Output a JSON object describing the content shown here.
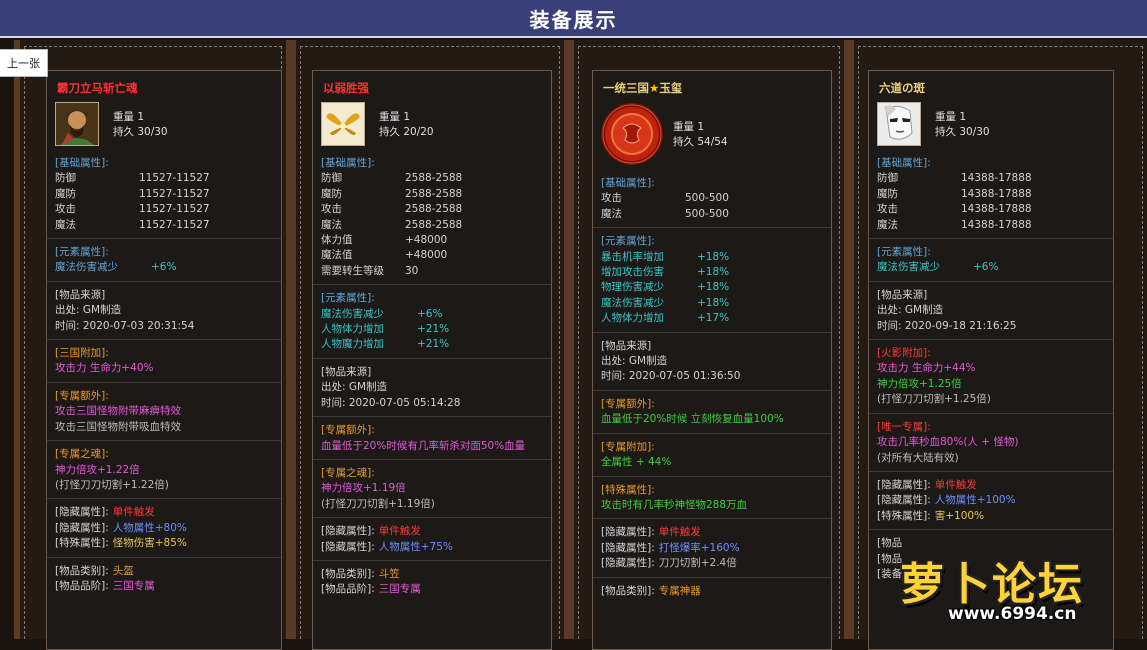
{
  "header": {
    "title": "装备展示"
  },
  "nav": {
    "prev_label": "上一张"
  },
  "cards": [
    {
      "name": "霸刀立马斩亡魂",
      "weight": "重量 1",
      "durability": "持久 30/30",
      "basic_title": "[基础属性]:",
      "basic": [
        {
          "k": "防御",
          "v": "11527-11527"
        },
        {
          "k": "魔防",
          "v": "11527-11527"
        },
        {
          "k": "攻击",
          "v": "11527-11527"
        },
        {
          "k": "魔法",
          "v": "11527-11527"
        }
      ],
      "element_title": "[元素属性]:",
      "elements": [
        {
          "k": "魔法伤害减少",
          "v": "+6%"
        }
      ],
      "source_title": "[物品来源]",
      "source_from": "出处: GM制造",
      "source_time": "时间: 2020-07-03 20:31:54",
      "s1_title": "[三国附加]:",
      "s1_line": "攻击力 生命力+40%",
      "s2_title": "[专属额外]:",
      "s2_line1": "攻击三国怪物附带麻痹特效",
      "s2_line2": "攻击三国怪物附带吸血特效",
      "s3_title": "[专属之魂]:",
      "s3_line1": "神力倍攻+1.22倍",
      "s3_line2": "(打怪刀刀切割+1.22倍)",
      "hidden": [
        {
          "l": "[隐藏属性]:",
          "v": "单件触发",
          "c": "red"
        },
        {
          "l": "[隐藏属性]:",
          "v": "人物属性+80%",
          "c": "blue"
        },
        {
          "l": "[特殊属性]:",
          "v": "怪物伤害+85%",
          "c": "yellow"
        }
      ],
      "category": [
        {
          "l": "[物品类别]:",
          "v": "头盔",
          "c": "orange"
        },
        {
          "l": "[物品品阶]:",
          "v": "三国专属",
          "c": "magenta"
        }
      ]
    },
    {
      "name": "以弱胜强",
      "weight": "重量 1",
      "durability": "持久 20/20",
      "basic_title": "[基础属性]:",
      "basic": [
        {
          "k": "防御",
          "v": "2588-2588"
        },
        {
          "k": "魔防",
          "v": "2588-2588"
        },
        {
          "k": "攻击",
          "v": "2588-2588"
        },
        {
          "k": "魔法",
          "v": "2588-2588"
        },
        {
          "k": "体力值",
          "v": "+48000"
        },
        {
          "k": "魔法值",
          "v": "+48000"
        },
        {
          "k": "需要转生等级",
          "v": "30"
        }
      ],
      "element_title": "[元素属性]:",
      "elements": [
        {
          "k": "魔法伤害减少",
          "v": "+6%"
        },
        {
          "k": "人物体力增加",
          "v": "+21%"
        },
        {
          "k": "人物魔力增加",
          "v": "+21%"
        }
      ],
      "source_title": "[物品来源]",
      "source_from": "出处: GM制造",
      "source_time": "时间: 2020-07-05 05:14:28",
      "s1_title": "[专属额外]:",
      "s1_line": "血量低于20%时候有几率斩杀对面50%血量",
      "s2_title": "[专属之魂]:",
      "s2_line1": "神力倍攻+1.19倍",
      "s2_line2": "(打怪刀刀切割+1.19倍)",
      "hidden": [
        {
          "l": "[隐藏属性]:",
          "v": "单件触发",
          "c": "red"
        },
        {
          "l": "[隐藏属性]:",
          "v": "人物属性+75%",
          "c": "blue"
        }
      ],
      "category": [
        {
          "l": "[物品类别]:",
          "v": "斗笠",
          "c": "orange"
        },
        {
          "l": "[物品品阶]:",
          "v": "三国专属",
          "c": "magenta"
        }
      ]
    },
    {
      "name_a": "一统三国",
      "name_star": "★",
      "name_b": "玉玺",
      "weight": "重量 1",
      "durability": "持久 54/54",
      "basic_title": "[基础属性]:",
      "basic": [
        {
          "k": "攻击",
          "v": "500-500"
        },
        {
          "k": "魔法",
          "v": "500-500"
        }
      ],
      "element_title": "[元素属性]:",
      "elements": [
        {
          "k": "暴击机率增加",
          "v": "+18%"
        },
        {
          "k": "增加攻击伤害",
          "v": "+18%"
        },
        {
          "k": "物理伤害减少",
          "v": "+18%"
        },
        {
          "k": "魔法伤害减少",
          "v": "+18%"
        },
        {
          "k": "人物体力增加",
          "v": "+17%"
        }
      ],
      "source_title": "[物品来源]",
      "source_from": "出处: GM制造",
      "source_time": "时间: 2020-07-05 01:36:50",
      "s1_title": "[专属额外]:",
      "s1_line": "血量低于20%时候 立刻恢复血量100%",
      "s2_title": "[专属附加]:",
      "s2_line": "全属性 + 44%",
      "s3_title": "[特殊属性]:",
      "s3_line": "攻击时有几率秒神怪物288万血",
      "hidden": [
        {
          "l": "[隐藏属性]:",
          "v": "单件触发",
          "c": "red"
        },
        {
          "l": "[隐藏属性]:",
          "v": "打怪爆率+160%",
          "c": "blue"
        },
        {
          "l": "[隐藏属性]:",
          "v": "刀刀切割+2.4倍",
          "c": "grey"
        }
      ],
      "category": [
        {
          "l": "[物品类别]:",
          "v": "专属神器",
          "c": "orange"
        }
      ]
    },
    {
      "name": "六道の斑",
      "weight": "重量 1",
      "durability": "持久 30/30",
      "basic_title": "[基础属性]:",
      "basic": [
        {
          "k": "防御",
          "v": "14388-17888"
        },
        {
          "k": "魔防",
          "v": "14388-17888"
        },
        {
          "k": "攻击",
          "v": "14388-17888"
        },
        {
          "k": "魔法",
          "v": "14388-17888"
        }
      ],
      "element_title": "[元素属性]:",
      "elements": [
        {
          "k": "魔法伤害减少",
          "v": "+6%"
        }
      ],
      "source_title": "[物品来源]",
      "source_from": "出处: GM制造",
      "source_time": "时间: 2020-09-18 21:16:25",
      "s1_title": "[火影附加]:",
      "s1_line1": "攻击力 生命力+44%",
      "s1_line2": "神力倍攻+1.25倍",
      "s1_line3": "(打怪刀刀切割+1.25倍)",
      "s2_title": "[唯一专属]:",
      "s2_line1": "攻击几率秒血80%(人 + 怪物)",
      "s2_line2": "(对所有大陆有效)",
      "hidden": [
        {
          "l": "[隐藏属性]:",
          "v": "单件触发",
          "c": "red"
        },
        {
          "l": "[隐藏属性]:",
          "v": "人物属性+100%",
          "c": "blue"
        },
        {
          "l": "[特殊属性]:",
          "v": "害+100%",
          "c": "yellow"
        }
      ],
      "tail": [
        "[物品",
        "[物品",
        "[装备出"
      ]
    }
  ],
  "watermark": {
    "text": "萝卜论坛",
    "url": "www.6994.cn"
  },
  "colors": {
    "header_bg": "#3a3f7a",
    "name_red": "#ff3030",
    "name_yellow": "#e8d27a",
    "cyan": "#36c7c7",
    "magenta": "#e35ad8",
    "green": "#3ecf3e",
    "orange": "#e89a2a"
  }
}
